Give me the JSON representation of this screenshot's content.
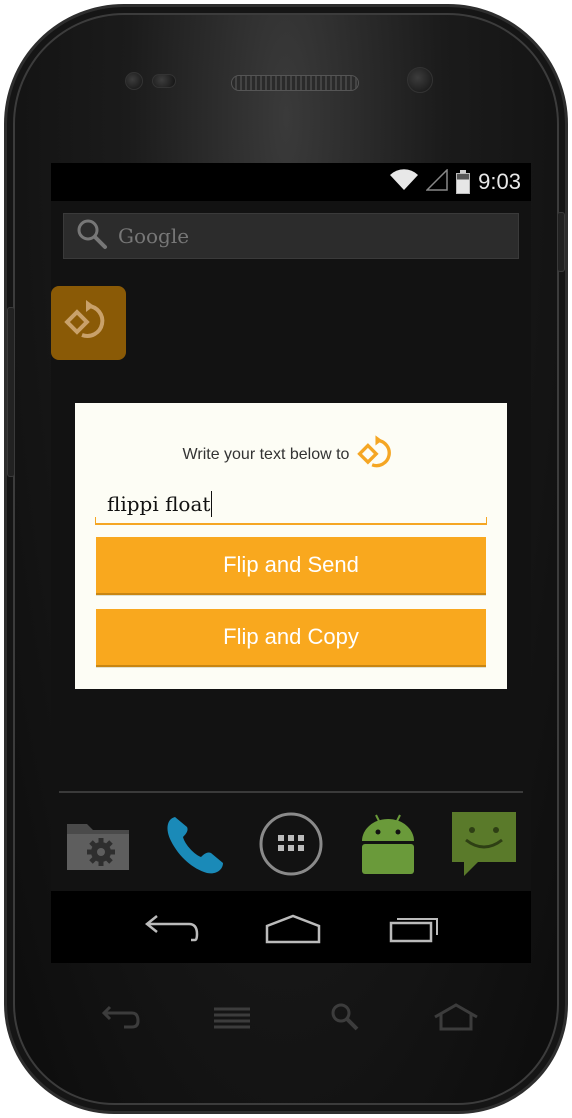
{
  "status_bar": {
    "time": "9:03",
    "icons": [
      "wifi-icon",
      "signal-icon",
      "battery-icon"
    ]
  },
  "search": {
    "placeholder": "Google",
    "icon": "search-icon"
  },
  "home_widget": {
    "icon": "flip-app-icon",
    "color": "#8a5a06"
  },
  "dialog": {
    "prompt": "Write your text below to",
    "logo_icon": "flip-logo-icon",
    "input_value": "flippi float",
    "buttons": {
      "flip_send": "Flip and Send",
      "flip_copy": "Flip and Copy"
    },
    "accent_color": "#f9a81e"
  },
  "dock": {
    "items": [
      "settings-folder-icon",
      "phone-icon",
      "app-drawer-icon",
      "android-icon",
      "messaging-icon"
    ]
  },
  "navbar": {
    "items": [
      "back-icon",
      "home-icon",
      "recents-icon"
    ]
  },
  "hardware_keys": {
    "items": [
      "back-key-icon",
      "menu-key-icon",
      "search-key-icon",
      "home-key-icon"
    ]
  }
}
